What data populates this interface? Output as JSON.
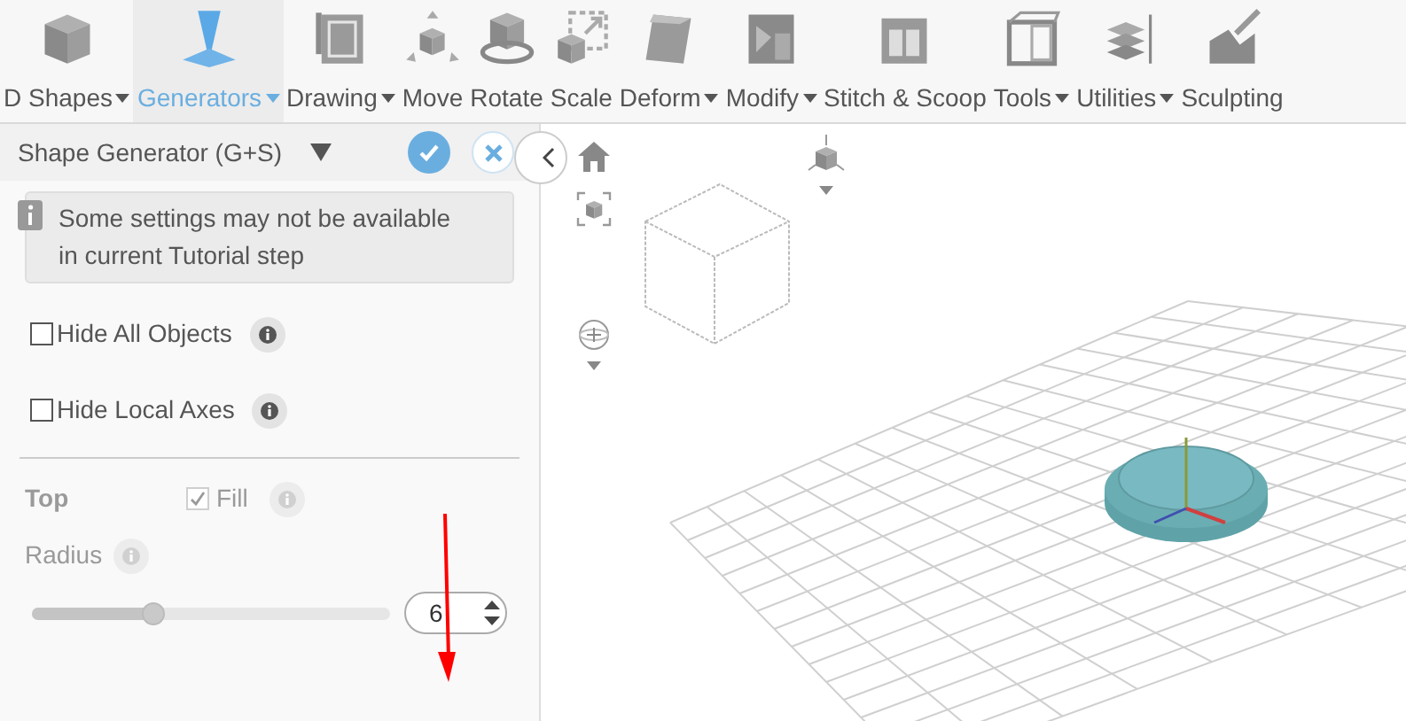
{
  "toolbar": [
    {
      "label": "D Shapes",
      "dropdown": true,
      "selected": false
    },
    {
      "label": "Generators",
      "dropdown": true,
      "selected": true
    },
    {
      "label": "Drawing",
      "dropdown": true,
      "selected": false
    },
    {
      "label": "Move",
      "dropdown": false,
      "selected": false
    },
    {
      "label": "Rotate",
      "dropdown": false,
      "selected": false
    },
    {
      "label": "Scale",
      "dropdown": false,
      "selected": false
    },
    {
      "label": "Deform",
      "dropdown": true,
      "selected": false
    },
    {
      "label": "Modify",
      "dropdown": true,
      "selected": false
    },
    {
      "label": "Stitch & Scoop",
      "dropdown": false,
      "selected": false
    },
    {
      "label": "Tools",
      "dropdown": true,
      "selected": false
    },
    {
      "label": "Utilities",
      "dropdown": true,
      "selected": false
    },
    {
      "label": "Sculpting",
      "dropdown": false,
      "selected": false
    }
  ],
  "panel": {
    "title": "Shape Generator (G+S)",
    "notice": "Some settings may not be available in current Tutorial step",
    "options": [
      {
        "label": "Hide All Objects",
        "checked": false
      },
      {
        "label": "Hide Local Axes",
        "checked": false
      }
    ],
    "section": {
      "title": "Top",
      "disabled": true,
      "fill": {
        "label": "Fill",
        "checked": true
      },
      "radius": {
        "label": "Radius",
        "level": 0.34,
        "value": "6"
      }
    }
  }
}
